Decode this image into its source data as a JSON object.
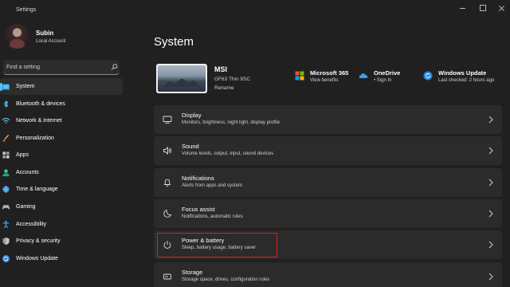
{
  "window": {
    "title": "Settings"
  },
  "user": {
    "name": "Subin",
    "account_type": "Local Account"
  },
  "search": {
    "placeholder": "Find a setting",
    "value": ""
  },
  "sidebar": {
    "items": [
      {
        "label": "System",
        "icon": "laptop-icon",
        "active": true
      },
      {
        "label": "Bluetooth & devices",
        "icon": "bluetooth-icon"
      },
      {
        "label": "Network & internet",
        "icon": "wifi-icon"
      },
      {
        "label": "Personalization",
        "icon": "brush-icon"
      },
      {
        "label": "Apps",
        "icon": "apps-icon"
      },
      {
        "label": "Accounts",
        "icon": "person-icon"
      },
      {
        "label": "Time & language",
        "icon": "globe-clock-icon"
      },
      {
        "label": "Gaming",
        "icon": "gamepad-icon"
      },
      {
        "label": "Accessibility",
        "icon": "accessibility-icon"
      },
      {
        "label": "Privacy & security",
        "icon": "shield-icon"
      },
      {
        "label": "Windows Update",
        "icon": "update-icon"
      }
    ]
  },
  "main": {
    "title": "System",
    "device": {
      "name": "MSI",
      "model": "GF63 Thin 9SC",
      "rename_label": "Rename"
    },
    "quick_links": [
      {
        "title": "Microsoft 365",
        "subtitle": "View benefits",
        "icon": "microsoft-logo-icon"
      },
      {
        "title": "OneDrive",
        "subtitle": "• Sign In",
        "icon": "cloud-icon"
      },
      {
        "title": "Windows Update",
        "subtitle": "Last checked: 2 hours ago",
        "icon": "update-icon"
      }
    ],
    "cards": [
      {
        "title": "Display",
        "subtitle": "Monitors, brightness, night light, display profile",
        "icon": "display-icon"
      },
      {
        "title": "Sound",
        "subtitle": "Volume levels, output, input, sound devices",
        "icon": "speaker-icon"
      },
      {
        "title": "Notifications",
        "subtitle": "Alerts from apps and system",
        "icon": "bell-icon"
      },
      {
        "title": "Focus assist",
        "subtitle": "Notifications, automatic rules",
        "icon": "moon-icon"
      },
      {
        "title": "Power & battery",
        "subtitle": "Sleep, battery usage, battery saver",
        "icon": "power-icon",
        "highlighted": true
      },
      {
        "title": "Storage",
        "subtitle": "Storage space, drives, configuration rules",
        "icon": "storage-icon"
      }
    ]
  },
  "colors": {
    "background": "#202020",
    "card": "#2b2b2b",
    "accent": "#4cc2ff",
    "highlight_border": "#e02020"
  }
}
